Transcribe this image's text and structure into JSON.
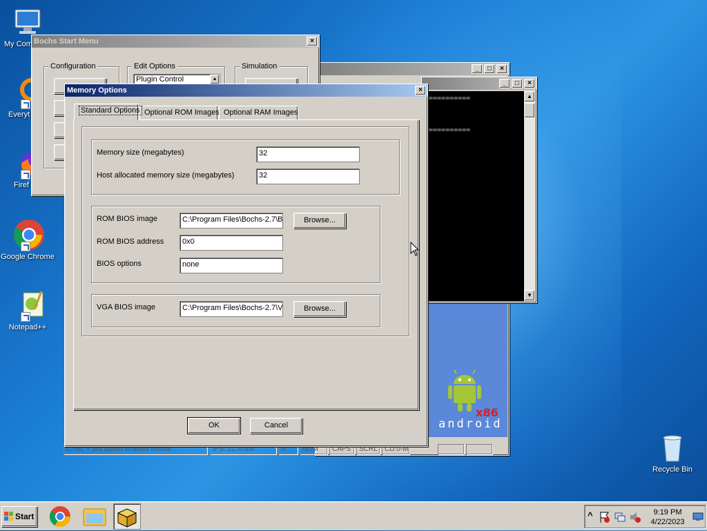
{
  "desktop": {
    "icons": [
      {
        "label": "My Com"
      },
      {
        "label": "Everyt"
      },
      {
        "label": "Firef"
      },
      {
        "label": "Google Chrome"
      },
      {
        "label": "Notepad++"
      },
      {
        "label": "Recycle Bin"
      }
    ]
  },
  "bochs_start_menu": {
    "title": "Bochs Start Menu",
    "config_group": "Configuration",
    "edit_group": "Edit Options",
    "edit_selected": "Plugin Control",
    "sim_group": "Simulation"
  },
  "console_window": {
    "lines": [
      "==========",
      "=========="
    ]
  },
  "vm_window": {
    "status_mouse": "CTRL + 3rd button enables mouse",
    "status_ips": "IPS: 21.404M",
    "status_a": "A:",
    "status_num": "NUM",
    "status_caps": "CAPS",
    "status_scrl": "SCRL",
    "status_cd": "CD:0-M",
    "android_x86": "x86",
    "android_word": "android"
  },
  "memory_dialog": {
    "title": "Memory Options",
    "tabs": [
      "Standard Options",
      "Optional ROM Images",
      "Optional RAM Images"
    ],
    "memory_size_label": "Memory size (megabytes)",
    "memory_size_value": "32",
    "host_mem_label": "Host allocated memory size (megabytes)",
    "host_mem_value": "32",
    "rom_bios_image_label": "ROM BIOS image",
    "rom_bios_image_value": "C:\\Program Files\\Bochs-2.7\\BI",
    "rom_bios_address_label": "ROM BIOS address",
    "rom_bios_address_value": "0x0",
    "bios_options_label": "BIOS options",
    "bios_options_value": "none",
    "vga_bios_image_label": "VGA BIOS image",
    "vga_bios_image_value": "C:\\Program Files\\Bochs-2.7\\VI",
    "browse_label": "Browse...",
    "ok_label": "OK",
    "cancel_label": "Cancel"
  },
  "taskbar": {
    "start_label": "Start",
    "time": "9:19 PM",
    "date": "4/22/2023",
    "tray_expand": "^"
  },
  "colors": {
    "accent_titlebar": "#0a246a",
    "android_green": "#a4c639",
    "android_bg": "#5b88d8"
  }
}
